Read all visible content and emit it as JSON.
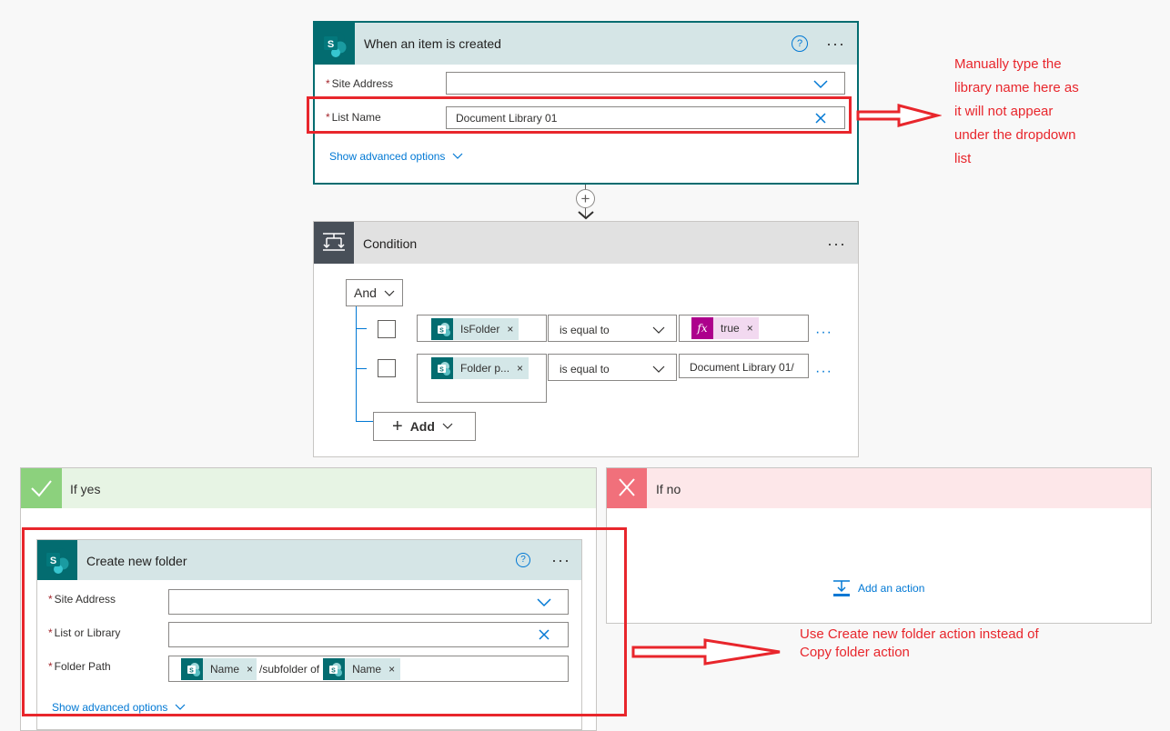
{
  "trigger": {
    "title": "When an item is created",
    "site_address_label": "Site Address",
    "site_address_value": "",
    "list_name_label": "List Name",
    "list_name_value": "Document Library 01",
    "advanced_label": "Show advanced options",
    "accent": "#036c70"
  },
  "condition": {
    "title": "Condition",
    "group_operator": "And",
    "rows": [
      {
        "left_token": "IsFolder",
        "operator": "is equal to",
        "right_token": "true"
      },
      {
        "left_token": "Folder p...",
        "operator": "is equal to",
        "right_value": "Document Library 01/"
      }
    ],
    "add_label": "Add"
  },
  "branches": {
    "yes_label": "If yes",
    "no_label": "If no",
    "yes_color": "#e7f4e4",
    "no_color": "#fde7e9",
    "add_action_label": "Add an action"
  },
  "create_folder": {
    "title": "Create new folder",
    "site_address_label": "Site Address",
    "list_label": "List or Library",
    "folder_path_label": "Folder Path",
    "token1": "Name",
    "path_text": "/subfolder of",
    "token2": "Name",
    "advanced_label": "Show advanced options"
  },
  "annotations": {
    "note1_lines": [
      "Manually type the",
      "library name here as",
      "it will not appear",
      "under the dropdown",
      "list"
    ],
    "note2_lines": [
      "Use Create new folder action instead of",
      "Copy folder action"
    ],
    "annotation_color": "#e8262c"
  }
}
